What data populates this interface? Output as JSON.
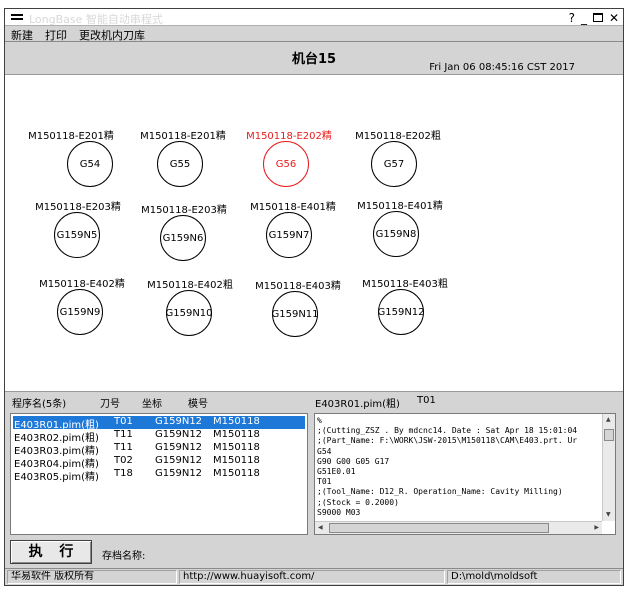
{
  "window": {
    "title": "LongBase 智能自动串程式",
    "controls": {
      "help": "?",
      "minimize": "_",
      "close": "✕"
    }
  },
  "menu": {
    "items": [
      {
        "label": "新建"
      },
      {
        "label": "打印"
      },
      {
        "label": "更改机内刀库"
      }
    ]
  },
  "header": {
    "machine_title": "机台15",
    "datetime": "Fri Jan 06 08:45:16 CST 2017"
  },
  "slots": [
    {
      "label": "M150118-E201精",
      "code": "G54",
      "active": false
    },
    {
      "label": "M150118-E201精",
      "code": "G55",
      "active": false
    },
    {
      "label": "M150118-E202精",
      "code": "G56",
      "active": true
    },
    {
      "label": "M150118-E202粗",
      "code": "G57",
      "active": false
    },
    {
      "label": "M150118-E203精",
      "code": "G159N5",
      "active": false
    },
    {
      "label": "M150118-E203精",
      "code": "G159N6",
      "active": false
    },
    {
      "label": "M150118-E401精",
      "code": "G159N7",
      "active": false
    },
    {
      "label": "M150118-E401精",
      "code": "G159N8",
      "active": false
    },
    {
      "label": "M150118-E402精",
      "code": "G159N9",
      "active": false
    },
    {
      "label": "M150118-E402粗",
      "code": "G159N10",
      "active": false
    },
    {
      "label": "M150118-E403精",
      "code": "G159N11",
      "active": false
    },
    {
      "label": "M150118-E403粗",
      "code": "G159N12",
      "active": false
    }
  ],
  "program_list": {
    "headers": {
      "name": "程序名(5条)",
      "tool": "刀号",
      "coord": "坐标",
      "mold": "模号"
    },
    "rows": [
      {
        "name": "E403R01.pim(粗)",
        "tool": "T01",
        "coord": "G159N12",
        "mold": "M150118",
        "selected": true
      },
      {
        "name": "E403R02.pim(粗)",
        "tool": "T11",
        "coord": "G159N12",
        "mold": "M150118",
        "selected": false
      },
      {
        "name": "E403R03.pim(精)",
        "tool": "T11",
        "coord": "G159N12",
        "mold": "M150118",
        "selected": false
      },
      {
        "name": "E403R04.pim(精)",
        "tool": "T02",
        "coord": "G159N12",
        "mold": "M150118",
        "selected": false
      },
      {
        "name": "E403R05.pim(精)",
        "tool": "T18",
        "coord": "G159N12",
        "mold": "M150118",
        "selected": false
      }
    ]
  },
  "code_view": {
    "file": "E403R01.pim(粗)",
    "tool": "T01",
    "lines": "%\n;(Cutting_ZSZ . By mdcnc14. Date : Sat Apr 18 15:01:04\n;(Part_Name: F:\\WORK\\JSW-2015\\M150118\\CAM\\E403.prt. Ur\nG54\nG90 G00 G05 G17\nG51E0.01\nT01\n;(Tool_Name: D12_R. Operation_Name: Cavity Milling)\n;(Stock = 0.2000)\nS9000 M03"
  },
  "actions": {
    "execute_label": "执 行",
    "archive_label": "存档名称:"
  },
  "status": {
    "copyright": "华易软件 版权所有",
    "url": "http://www.huayisoft.com/",
    "path": "D:\\mold\\moldsoft"
  },
  "colors": {
    "active_slot": "#e81c1c",
    "selection": "#1e78d8"
  }
}
